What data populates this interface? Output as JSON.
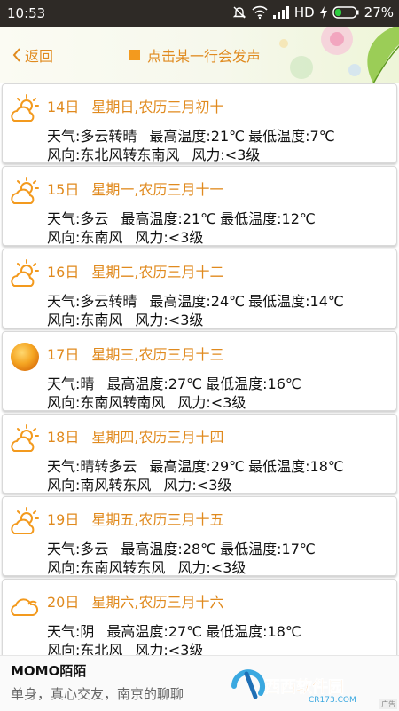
{
  "status": {
    "time": "10:53",
    "network": "HD",
    "battery": "27%"
  },
  "header": {
    "back_label": "返回",
    "hint": "点击某一行会发声"
  },
  "days": [
    {
      "date": "14日",
      "info": "星期日,农历三月初十",
      "weather": "天气:多云转晴",
      "high": "最高温度:21℃",
      "low": "最低温度:7℃",
      "wind_dir": "风向:东北风转东南风",
      "wind_force": "风力:<3级",
      "icon": "partly-cloudy-icon"
    },
    {
      "date": "15日",
      "info": "星期一,农历三月十一",
      "weather": "天气:多云",
      "high": "最高温度:21℃",
      "low": "最低温度:12℃",
      "wind_dir": "风向:东南风",
      "wind_force": "风力:<3级",
      "icon": "partly-cloudy-icon"
    },
    {
      "date": "16日",
      "info": "星期二,农历三月十二",
      "weather": "天气:多云转晴",
      "high": "最高温度:24℃",
      "low": "最低温度:14℃",
      "wind_dir": "风向:东南风",
      "wind_force": "风力:<3级",
      "icon": "partly-cloudy-icon"
    },
    {
      "date": "17日",
      "info": "星期三,农历三月十三",
      "weather": "天气:晴",
      "high": "最高温度:27℃",
      "low": "最低温度:16℃",
      "wind_dir": "风向:东南风转南风",
      "wind_force": "风力:<3级",
      "icon": "sun-icon"
    },
    {
      "date": "18日",
      "info": "星期四,农历三月十四",
      "weather": "天气:晴转多云",
      "high": "最高温度:29℃",
      "low": "最低温度:18℃",
      "wind_dir": "风向:南风转东风",
      "wind_force": "风力:<3级",
      "icon": "partly-cloudy-icon"
    },
    {
      "date": "19日",
      "info": "星期五,农历三月十五",
      "weather": "天气:多云",
      "high": "最高温度:28℃",
      "low": "最低温度:17℃",
      "wind_dir": "风向:东南风转东风",
      "wind_force": "风力:<3级",
      "icon": "partly-cloudy-icon"
    },
    {
      "date": "20日",
      "info": "星期六,农历三月十六",
      "weather": "天气:阴",
      "high": "最高温度:27℃",
      "low": "最低温度:18℃",
      "wind_dir": "风向:东北风",
      "wind_force": "风力:<3级",
      "icon": "cloud-icon"
    }
  ],
  "ad": {
    "title": "MOMO陌陌",
    "subtitle": "单身，真心交友，南京的聊聊",
    "logo_text": "西西软件园",
    "logo_sub": "CR173.COM",
    "ad_mark": "广告"
  },
  "colors": {
    "accent": "#e08a1e",
    "icon_orange": "#f39a1e"
  }
}
